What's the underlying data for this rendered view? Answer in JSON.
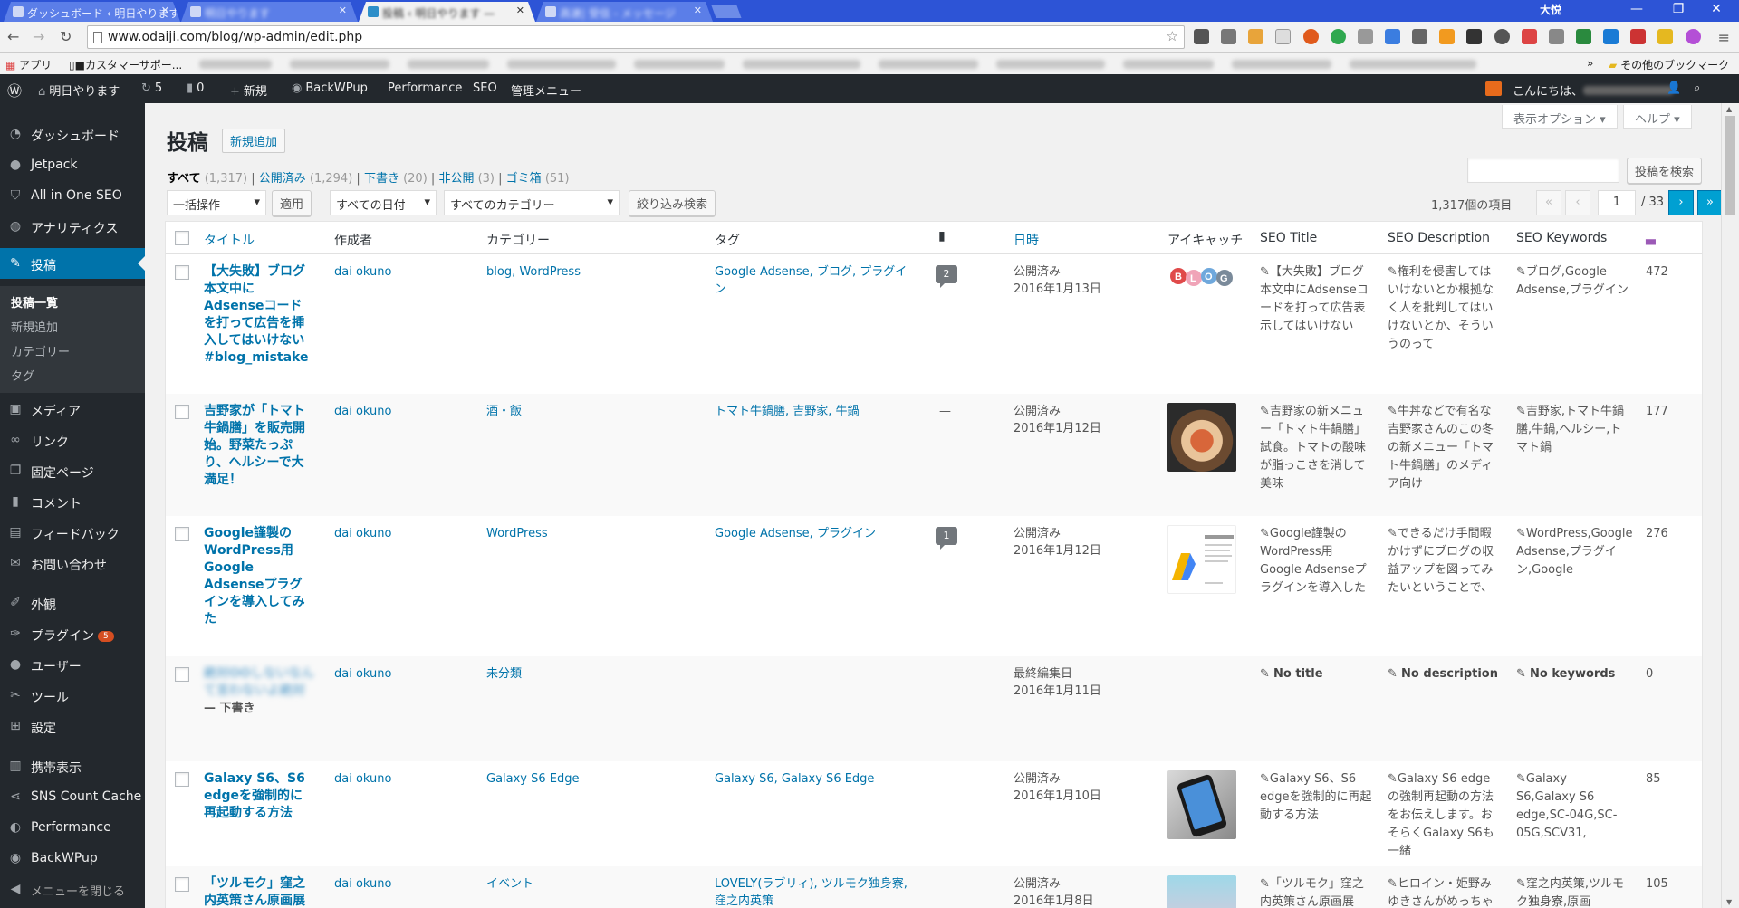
{
  "browser": {
    "tabs": [
      {
        "title": "ダッシュボード ‹ 明日やります"
      },
      {
        "title": "明日やります"
      },
      {
        "title": "投稿 ‹ 明日やります — "
      },
      {
        "title": "高速| 受信 - メッセージ"
      }
    ],
    "profile_name": "大悦",
    "url": "www.odaiji.com/blog/wp-admin/edit.php",
    "bookmarks": {
      "apps": "アプリ",
      "first": "■カスタマーサポー...",
      "other": "その他のブックマーク"
    }
  },
  "adminbar": {
    "site_name": "明日やります",
    "updates_count": "5",
    "comments_count": "0",
    "new_label": "新規",
    "backwpup": "BackWPup",
    "performance": "Performance",
    "seo": "SEO",
    "manage_menu": "管理メニュー",
    "greeting": "こんにちは、"
  },
  "sidebar": {
    "items": [
      {
        "label": "ダッシュボード",
        "icon": "gauge-icon"
      },
      {
        "label": "Jetpack",
        "icon": "jetpack-icon"
      },
      {
        "label": "All in One SEO",
        "icon": "shield-icon"
      },
      {
        "label": "アナリティクス",
        "icon": "analytics-icon"
      },
      {
        "label": "投稿",
        "icon": "pin-icon"
      },
      {
        "label": "メディア",
        "icon": "media-icon"
      },
      {
        "label": "リンク",
        "icon": "link-icon"
      },
      {
        "label": "固定ページ",
        "icon": "pages-icon"
      },
      {
        "label": "コメント",
        "icon": "comment-icon"
      },
      {
        "label": "フィードバック",
        "icon": "feedback-icon"
      },
      {
        "label": "お問い合わせ",
        "icon": "mail-icon"
      },
      {
        "label": "外観",
        "icon": "brush-icon"
      },
      {
        "label": "プラグイン",
        "icon": "plugin-icon",
        "badge": "5"
      },
      {
        "label": "ユーザー",
        "icon": "user-icon"
      },
      {
        "label": "ツール",
        "icon": "wrench-icon"
      },
      {
        "label": "設定",
        "icon": "settings-icon"
      },
      {
        "label": "携帯表示",
        "icon": "mobile-icon"
      },
      {
        "label": "SNS Count Cache",
        "icon": "share-icon"
      },
      {
        "label": "Performance",
        "icon": "performance-icon"
      },
      {
        "label": "BackWPup",
        "icon": "backwpup-icon"
      },
      {
        "label": "メニューを閉じる",
        "icon": "collapse-icon"
      }
    ],
    "submenu": [
      "投稿一覧",
      "新規追加",
      "カテゴリー",
      "タグ"
    ]
  },
  "page": {
    "screen_options": "表示オプション ▾",
    "help": "ヘルプ ▾",
    "title": "投稿",
    "add_new": "新規追加",
    "filters": {
      "all": "すべて",
      "all_count": "(1,317)",
      "published": "公開済み",
      "published_count": "(1,294)",
      "drafts": "下書き",
      "drafts_count": "(20)",
      "private": "非公開",
      "private_count": "(3)",
      "trash": "ゴミ箱",
      "trash_count": "(51)"
    },
    "search_button": "投稿を検索",
    "bulk_action": "一括操作",
    "apply": "適用",
    "date_filter": "すべての日付",
    "category_filter": "すべてのカテゴリー",
    "filter_button": "絞り込み検索",
    "items_count": "1,317個の項目",
    "current_page": "1",
    "total_pages": "/ 33"
  },
  "table": {
    "columns": {
      "title": "タイトル",
      "author": "作成者",
      "categories": "カテゴリー",
      "tags": "タグ",
      "date": "日時",
      "thumbnail": "アイキャッチ",
      "seo_title": "SEO Title",
      "seo_desc": "SEO Description",
      "seo_keywords": "SEO Keywords"
    },
    "rows": [
      {
        "title": "【大失敗】ブログ本文中にAdsenseコードを打って広告を挿入してはいけない #blog_mistake",
        "author": "dai okuno",
        "categories": "blog, WordPress",
        "tags": "Google Adsense, ブログ, プラグイン",
        "comments": "2",
        "status": "公開済み",
        "date": "2016年1月13日",
        "seo_title": "【大失敗】ブログ本文中にAdsenseコードを打って広告表示してはいけない",
        "seo_desc": "権利を侵害してはいけないとか根拠なく人を批判してはいけないとか、そういうのって",
        "seo_keywords": "ブログ,Google Adsense,プラグイン",
        "views": "472"
      },
      {
        "title": "吉野家が「トマト牛鍋膳」を販売開始。野菜たっぷり、ヘルシーで大満足！",
        "author": "dai okuno",
        "categories": "酒・飯",
        "tags": "トマト牛鍋膳, 吉野家, 牛鍋",
        "comments": "—",
        "status": "公開済み",
        "date": "2016年1月12日",
        "seo_title": "吉野家の新メニュー「トマト牛鍋膳」試食。トマトの酸味が脂っこさを消して美味",
        "seo_desc": "牛丼などで有名な吉野家さんのこの冬の新メニュー「トマト牛鍋膳」のメディア向け",
        "seo_keywords": "吉野家,トマト牛鍋膳,牛鍋,ヘルシー,トマト鍋",
        "views": "177"
      },
      {
        "title": "Google謹製のWordPress用Google Adsenseプラグインを導入してみた",
        "author": "dai okuno",
        "categories": "WordPress",
        "tags": "Google Adsense, プラグイン",
        "comments": "1",
        "status": "公開済み",
        "date": "2016年1月12日",
        "seo_title": "Google謹製のWordPress用Google Adsenseプラグインを導入した",
        "seo_desc": "できるだけ手間暇かけずにブログの収益アップを図ってみたいということで、",
        "seo_keywords": "WordPress,Google Adsense,プラグイン,Google",
        "views": "276"
      },
      {
        "title": "絶対OOしないなんて言わないよ絶対",
        "draft_label": "— 下書き",
        "author": "dai okuno",
        "categories": "未分類",
        "tags": "—",
        "comments": "—",
        "status": "最終編集日",
        "date": "2016年1月11日",
        "seo_title": "No title",
        "seo_desc": "No description",
        "seo_keywords": "No keywords",
        "views": "0"
      },
      {
        "title": "Galaxy S6、S6 edgeを強制的に再起動する方法",
        "author": "dai okuno",
        "categories": "Galaxy S6 Edge",
        "tags": "Galaxy S6, Galaxy S6 Edge",
        "comments": "—",
        "status": "公開済み",
        "date": "2016年1月10日",
        "seo_title": "Galaxy S6、S6 edgeを強制的に再起動する方法",
        "seo_desc": "Galaxy S6 edgeの強制再起動の方法をお伝えします。おそらくGalaxy S6も一緒",
        "seo_keywords": "Galaxy S6,Galaxy S6 edge,SC-04G,SC-05G,SCV31,",
        "views": "85"
      },
      {
        "title": "「ツルモク」窪之内英策さん原画展",
        "author": "dai okuno",
        "categories": "イベント",
        "tags": "LOVELY(ラブリィ), ツルモク独身寮, 窪之内英策",
        "comments": "—",
        "status": "公開済み",
        "date": "2016年1月8日",
        "seo_title": "「ツルモク」窪之内英策さん原画展",
        "seo_desc": "ヒロイン・姫野みゆきさんがめっちゃ可愛",
        "seo_keywords": "窪之内英策,ツルモク独身寮,原画",
        "views": "105"
      }
    ]
  },
  "colors": {
    "admin_dark": "#23282d",
    "link_blue": "#0073aa",
    "current_menu": "#0073aa",
    "chrome_tabbar": "#2d54d6"
  }
}
